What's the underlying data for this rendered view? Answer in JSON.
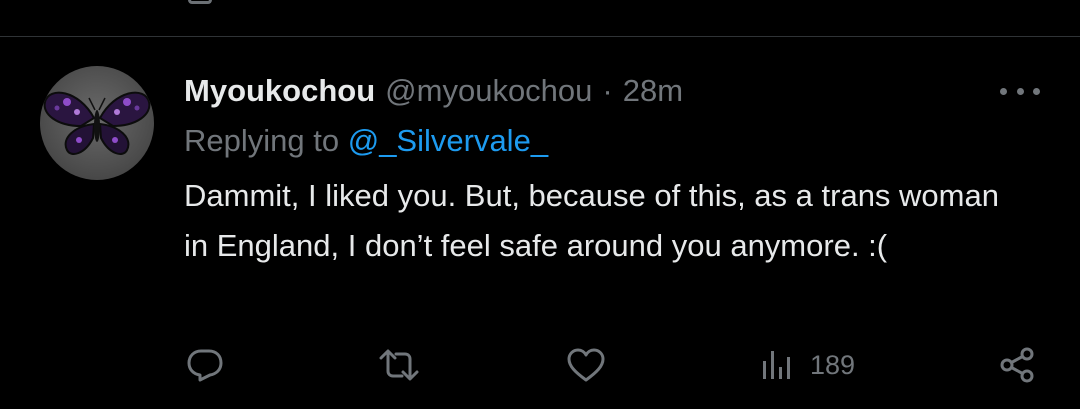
{
  "tweet": {
    "display_name": "Myoukochou",
    "handle": "@myoukochou",
    "separator": "·",
    "time": "28m",
    "replying_prefix": "Replying to",
    "replying_to": "@_Silvervale_",
    "text": "Dammit, I liked you. But, because of this, as a trans woman in England, I don’t feel safe around you anymore. :(",
    "views": "189"
  },
  "icons": {
    "reply": "reply-icon",
    "retweet": "retweet-icon",
    "like": "heart-icon",
    "views": "views-icon",
    "share": "share-icon",
    "more": "more-icon"
  },
  "colors": {
    "background": "#000000",
    "text": "#e7e9ea",
    "muted": "#71767b",
    "link": "#1d9bf0",
    "divider": "#2f3336"
  }
}
